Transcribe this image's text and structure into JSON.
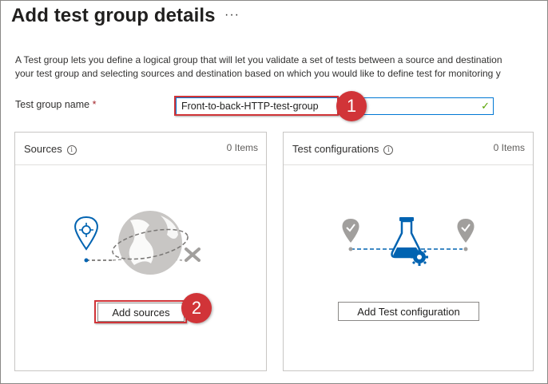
{
  "header": {
    "title": "Add test group details",
    "more_label": "···"
  },
  "description": {
    "line1": "A Test group lets you define a logical group that will let you validate a set of tests between a source and destination",
    "line2": "your test group and selecting sources and destination based on which you would like to define test for monitoring y"
  },
  "form": {
    "name_label": "Test group name",
    "required_marker": "*",
    "name_value": "Front-to-back-HTTP-test-group"
  },
  "callouts": {
    "step1": "1",
    "step2": "2"
  },
  "sources_panel": {
    "title": "Sources",
    "count": "0 Items",
    "button_label": "Add sources"
  },
  "tests_panel": {
    "title": "Test configurations",
    "count": "0 Items",
    "button_label": "Add Test configuration"
  },
  "colors": {
    "accent": "#0078d4",
    "highlight": "#d13438",
    "valid": "#57a300"
  }
}
